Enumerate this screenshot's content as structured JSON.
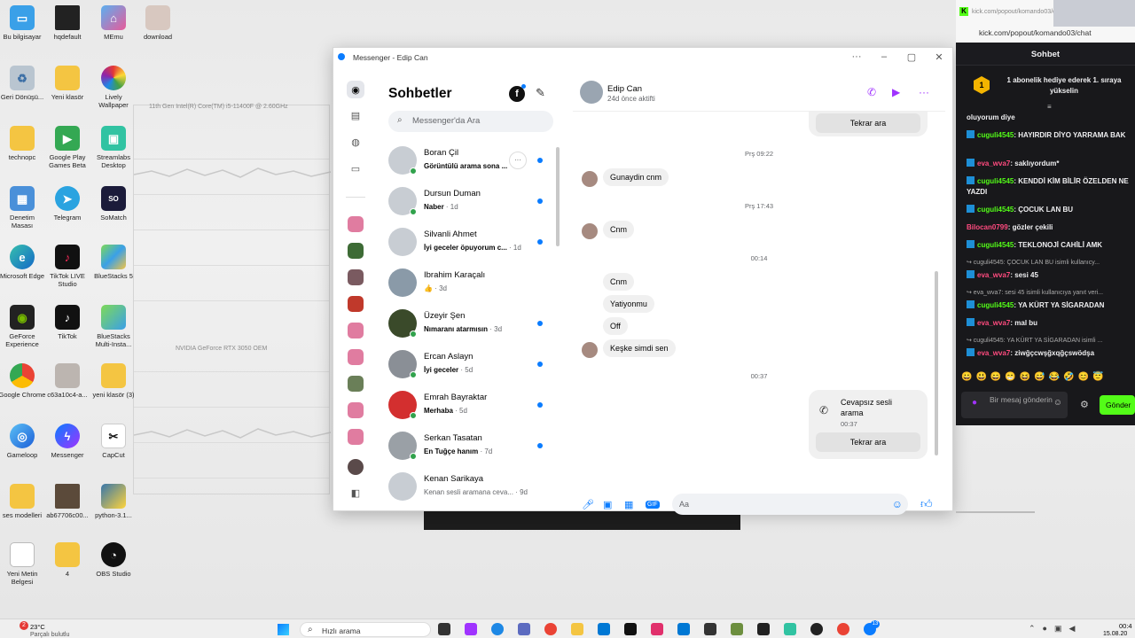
{
  "desktop": {
    "icons_col1": [
      "Bu bilgisayar",
      "Geri Dönüşü...",
      "technopc",
      "Denetim Masası",
      "Microsoft Edge",
      "GeForce Experience",
      "Google Chrome",
      "Gameloop",
      "ses modelleri",
      "Yeni Metin Belgesi"
    ],
    "icons_col2": [
      "hqdefault",
      "Yeni klasör",
      "Google Play Games Beta",
      "Telegram",
      "TikTok LIVE Studio",
      "TikTok",
      "c63a10c4-a...",
      "Messenger",
      "ab67706c00...",
      "4"
    ],
    "icons_col3": [
      "MEmu",
      "Lively Wallpaper",
      "Streamlabs Desktop",
      "SoMatch",
      "BlueStacks 5",
      "BlueStacks Multi-Insta...",
      "yeni klasör (3)",
      "CapCut",
      "python-3.1...",
      "OBS Studio"
    ],
    "icons_col4": [
      "download"
    ],
    "bg_cpu_label": "11th Gen Intel(R) Core(TM) i5-11400F @ 2.60GHz",
    "bg_gpu_label": "NVIDIA GeForce RTX 3050 OEM"
  },
  "messenger": {
    "window_title": "Messenger - Edip Can",
    "heading": "Sohbetler",
    "search_placeholder": "Messenger'da Ara",
    "conversations": [
      {
        "name": "Boran Çil",
        "preview": "Görüntülü arama sona ...",
        "time": "",
        "bold": true,
        "unread": true
      },
      {
        "name": "Dursun Duman",
        "preview": "Naber",
        "time": "· 1d",
        "bold": true,
        "unread": true
      },
      {
        "name": "Silvanli Ahmet",
        "preview": "İyi geceler öpuyorum c...",
        "time": "· 1d",
        "bold": true,
        "unread": true
      },
      {
        "name": "Ibrahim Karaçalı",
        "preview": "👍",
        "time": "· 3d",
        "bold": false,
        "unread": false
      },
      {
        "name": "Üzeyir Şen",
        "preview": "Nımaranı atarmısın",
        "time": "· 3d",
        "bold": true,
        "unread": true
      },
      {
        "name": "Ercan Aslayn",
        "preview": "İyi geceler",
        "time": "· 5d",
        "bold": true,
        "unread": true
      },
      {
        "name": "Emrah Bayraktar",
        "preview": "Merhaba",
        "time": "· 5d",
        "bold": true,
        "unread": true
      },
      {
        "name": "Serkan Tasatan",
        "preview": "En Tuğçe hanım",
        "time": "· 7d",
        "bold": true,
        "unread": true
      },
      {
        "name": "Kenan Sarikaya",
        "preview": "Kenan sesli aramana ceva...",
        "time": "· 9d",
        "bold": false,
        "unread": false
      }
    ],
    "chat": {
      "contact_name": "Edip Can",
      "contact_status": "24d önce aktifti",
      "retry_label_top": "Tekrar ara",
      "ts1": "Prş 09:22",
      "msg1": "Gunaydin  cnm",
      "ts2": "Prş 17:43",
      "msg2": "Cnm",
      "ts3": "00:14",
      "msg3": "Cnm",
      "msg4": "Yatiyonmu",
      "msg5": "Off",
      "msg6": "Keşke simdi sen",
      "ts4": "00:37",
      "missed_call_title": "Cevapsız sesli arama",
      "missed_call_time": "00:37",
      "retry_label": "Tekrar ara",
      "composer_placeholder": "Aa"
    }
  },
  "kick": {
    "url_host": "kick.com/popout/komando03/chat",
    "url_full": "kick.com/popout/komando03/chat",
    "title": "Sohbet",
    "gift_rank": "1",
    "gift_text": "1 abonelik hediye ederek 1. sıraya yükselin",
    "messages": [
      {
        "user": "",
        "text": "oluyorum diye",
        "kind": "plain"
      },
      {
        "user": "cuguli4545",
        "text": ": HAYIRDIR DİYO YARRAMA BAK",
        "kind": "green"
      },
      {
        "user": "eva_wva7",
        "text": ": saklıyordum*",
        "kind": "pink"
      },
      {
        "user": "cuguli4545",
        "text": ": KENDDİ KİM BİLİR ÖZELDEN NE YAZDI",
        "kind": "green"
      },
      {
        "user": "cuguli4545",
        "text": ": ÇOCUK LAN BU",
        "kind": "green"
      },
      {
        "user": "Bilocan0799",
        "text": ": gözler çekili",
        "kind": "pinknobadge"
      },
      {
        "user": "cuguli4545",
        "text": ": TEKLONOJİ CAHİLİ AMK",
        "kind": "green"
      },
      {
        "user": "",
        "text": "↪ cuguli4545: ÇOCUK LAN BU isimli kullanıcy...",
        "kind": "reply"
      },
      {
        "user": "eva_wva7",
        "text": ": sesi 45",
        "kind": "pink"
      },
      {
        "user": "",
        "text": "↪ eva_wva7: sesi 45 isimli kullanıcıya yanıt veri...",
        "kind": "reply"
      },
      {
        "user": "cuguli4545",
        "text": ": YA KÜRT YA SİGARADAN",
        "kind": "green"
      },
      {
        "user": "eva_wva7",
        "text": ": mal bu",
        "kind": "pink"
      },
      {
        "user": "",
        "text": "↪ cuguli4545: YA KÜRT YA SİGARADAN isimli ...",
        "kind": "reply"
      },
      {
        "user": "eva_wva7",
        "text": ": ziwğçcwşğxqğçswödşa",
        "kind": "pink"
      }
    ],
    "input_placeholder": "Bir mesaj gönderin",
    "send_label": "Gönder"
  },
  "taskbar": {
    "temperature": "23°C",
    "weather": "Parçalı bulutlu",
    "search_label": "Hızlı arama",
    "time": "00:4",
    "date": "15.08.20",
    "notification_count": "13",
    "weather_badge": "2"
  }
}
